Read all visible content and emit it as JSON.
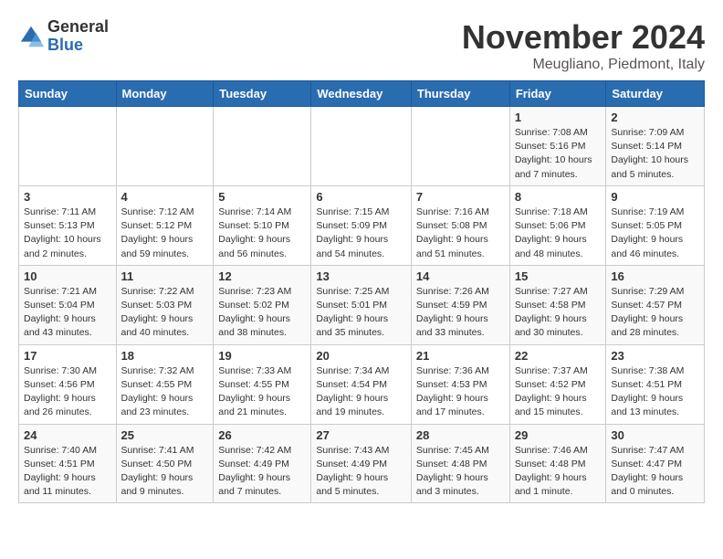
{
  "header": {
    "logo_general": "General",
    "logo_blue": "Blue",
    "month_title": "November 2024",
    "location": "Meugliano, Piedmont, Italy"
  },
  "days_of_week": [
    "Sunday",
    "Monday",
    "Tuesday",
    "Wednesday",
    "Thursday",
    "Friday",
    "Saturday"
  ],
  "weeks": [
    [
      {
        "day": "",
        "info": ""
      },
      {
        "day": "",
        "info": ""
      },
      {
        "day": "",
        "info": ""
      },
      {
        "day": "",
        "info": ""
      },
      {
        "day": "",
        "info": ""
      },
      {
        "day": "1",
        "info": "Sunrise: 7:08 AM\nSunset: 5:16 PM\nDaylight: 10 hours and 7 minutes."
      },
      {
        "day": "2",
        "info": "Sunrise: 7:09 AM\nSunset: 5:14 PM\nDaylight: 10 hours and 5 minutes."
      }
    ],
    [
      {
        "day": "3",
        "info": "Sunrise: 7:11 AM\nSunset: 5:13 PM\nDaylight: 10 hours and 2 minutes."
      },
      {
        "day": "4",
        "info": "Sunrise: 7:12 AM\nSunset: 5:12 PM\nDaylight: 9 hours and 59 minutes."
      },
      {
        "day": "5",
        "info": "Sunrise: 7:14 AM\nSunset: 5:10 PM\nDaylight: 9 hours and 56 minutes."
      },
      {
        "day": "6",
        "info": "Sunrise: 7:15 AM\nSunset: 5:09 PM\nDaylight: 9 hours and 54 minutes."
      },
      {
        "day": "7",
        "info": "Sunrise: 7:16 AM\nSunset: 5:08 PM\nDaylight: 9 hours and 51 minutes."
      },
      {
        "day": "8",
        "info": "Sunrise: 7:18 AM\nSunset: 5:06 PM\nDaylight: 9 hours and 48 minutes."
      },
      {
        "day": "9",
        "info": "Sunrise: 7:19 AM\nSunset: 5:05 PM\nDaylight: 9 hours and 46 minutes."
      }
    ],
    [
      {
        "day": "10",
        "info": "Sunrise: 7:21 AM\nSunset: 5:04 PM\nDaylight: 9 hours and 43 minutes."
      },
      {
        "day": "11",
        "info": "Sunrise: 7:22 AM\nSunset: 5:03 PM\nDaylight: 9 hours and 40 minutes."
      },
      {
        "day": "12",
        "info": "Sunrise: 7:23 AM\nSunset: 5:02 PM\nDaylight: 9 hours and 38 minutes."
      },
      {
        "day": "13",
        "info": "Sunrise: 7:25 AM\nSunset: 5:01 PM\nDaylight: 9 hours and 35 minutes."
      },
      {
        "day": "14",
        "info": "Sunrise: 7:26 AM\nSunset: 4:59 PM\nDaylight: 9 hours and 33 minutes."
      },
      {
        "day": "15",
        "info": "Sunrise: 7:27 AM\nSunset: 4:58 PM\nDaylight: 9 hours and 30 minutes."
      },
      {
        "day": "16",
        "info": "Sunrise: 7:29 AM\nSunset: 4:57 PM\nDaylight: 9 hours and 28 minutes."
      }
    ],
    [
      {
        "day": "17",
        "info": "Sunrise: 7:30 AM\nSunset: 4:56 PM\nDaylight: 9 hours and 26 minutes."
      },
      {
        "day": "18",
        "info": "Sunrise: 7:32 AM\nSunset: 4:55 PM\nDaylight: 9 hours and 23 minutes."
      },
      {
        "day": "19",
        "info": "Sunrise: 7:33 AM\nSunset: 4:55 PM\nDaylight: 9 hours and 21 minutes."
      },
      {
        "day": "20",
        "info": "Sunrise: 7:34 AM\nSunset: 4:54 PM\nDaylight: 9 hours and 19 minutes."
      },
      {
        "day": "21",
        "info": "Sunrise: 7:36 AM\nSunset: 4:53 PM\nDaylight: 9 hours and 17 minutes."
      },
      {
        "day": "22",
        "info": "Sunrise: 7:37 AM\nSunset: 4:52 PM\nDaylight: 9 hours and 15 minutes."
      },
      {
        "day": "23",
        "info": "Sunrise: 7:38 AM\nSunset: 4:51 PM\nDaylight: 9 hours and 13 minutes."
      }
    ],
    [
      {
        "day": "24",
        "info": "Sunrise: 7:40 AM\nSunset: 4:51 PM\nDaylight: 9 hours and 11 minutes."
      },
      {
        "day": "25",
        "info": "Sunrise: 7:41 AM\nSunset: 4:50 PM\nDaylight: 9 hours and 9 minutes."
      },
      {
        "day": "26",
        "info": "Sunrise: 7:42 AM\nSunset: 4:49 PM\nDaylight: 9 hours and 7 minutes."
      },
      {
        "day": "27",
        "info": "Sunrise: 7:43 AM\nSunset: 4:49 PM\nDaylight: 9 hours and 5 minutes."
      },
      {
        "day": "28",
        "info": "Sunrise: 7:45 AM\nSunset: 4:48 PM\nDaylight: 9 hours and 3 minutes."
      },
      {
        "day": "29",
        "info": "Sunrise: 7:46 AM\nSunset: 4:48 PM\nDaylight: 9 hours and 1 minute."
      },
      {
        "day": "30",
        "info": "Sunrise: 7:47 AM\nSunset: 4:47 PM\nDaylight: 9 hours and 0 minutes."
      }
    ]
  ]
}
